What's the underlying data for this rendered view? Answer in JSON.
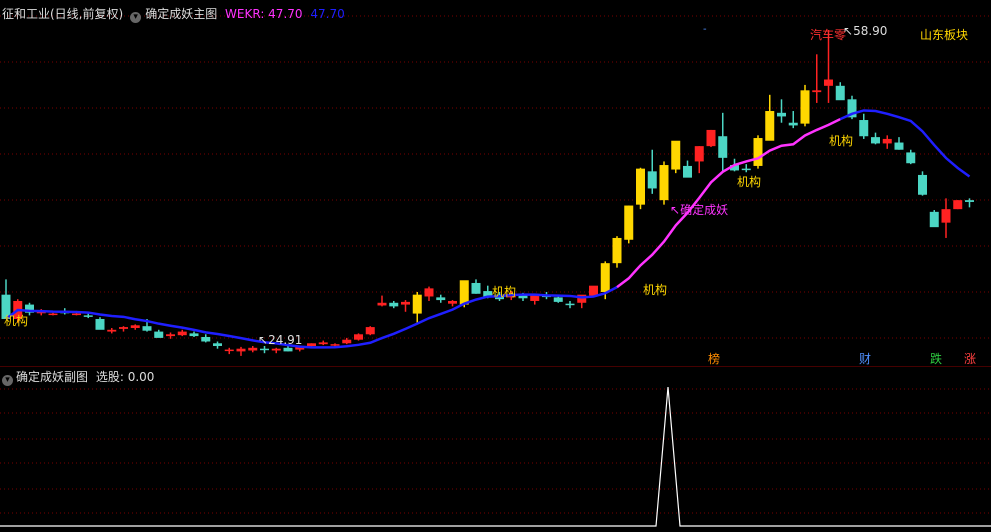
{
  "main": {
    "stock_title": "征和工业(日线,前复权)",
    "indicator_name": "确定成妖主图",
    "wekr_label": "WEKR: 47.70",
    "wekr_value2": "47.70",
    "high_label": "58.90",
    "low_label": "24.91",
    "signal_label": "确定成妖",
    "sector_label": "汽车零",
    "sector2_label": "山东板块",
    "inst_label": "机构",
    "dash_label": "-",
    "bottom_markers": [
      {
        "text": "榜",
        "color": "#ff8c00"
      },
      {
        "text": "财",
        "color": "#4f8fff"
      },
      {
        "text": "跌",
        "color": "#2ecc40"
      },
      {
        "text": "涨",
        "color": "#ff4040"
      }
    ]
  },
  "sub": {
    "title": "确定成妖副图",
    "value_label": "选股: 0.00"
  },
  "colors": {
    "up_red": "#ff2222",
    "down_cyan": "#4cd6c4",
    "yellow": "#ffd700",
    "ma_blue": "#1f1fff",
    "ma_magenta": "#ff33ff",
    "grid_red": "#8b0000"
  },
  "chart_data": {
    "type": "candlestick",
    "price_high": 58.9,
    "price_low": 24.91,
    "indicator": {
      "name": "WEKR",
      "value": 47.7
    },
    "candles_ohlc": [
      [
        29.5,
        31.2,
        26.8,
        26.8
      ],
      [
        26.8,
        29.0,
        26.4,
        28.8
      ],
      [
        28.4,
        28.6,
        27.2,
        27.5
      ],
      [
        27.6,
        27.9,
        27.2,
        27.6
      ],
      [
        27.3,
        27.5,
        27.2,
        27.4
      ],
      [
        27.6,
        28.0,
        27.3,
        27.5
      ],
      [
        27.4,
        27.7,
        27.2,
        27.4
      ],
      [
        27.2,
        27.5,
        26.9,
        27.1
      ],
      [
        26.8,
        27.0,
        25.8,
        25.6
      ],
      [
        25.4,
        25.8,
        25.2,
        25.6
      ],
      [
        25.7,
        26.0,
        25.4,
        25.9
      ],
      [
        25.8,
        26.2,
        25.6,
        26.1
      ],
      [
        26.0,
        26.8,
        25.4,
        25.5
      ],
      [
        25.4,
        25.6,
        24.8,
        24.7
      ],
      [
        24.9,
        25.3,
        24.6,
        25.1
      ],
      [
        25.0,
        25.6,
        24.9,
        25.4
      ],
      [
        25.2,
        25.4,
        24.8,
        24.9
      ],
      [
        24.8,
        25.1,
        24.2,
        24.3
      ],
      [
        24.1,
        24.3,
        23.5,
        23.8
      ],
      [
        23.4,
        23.6,
        22.9,
        23.4
      ],
      [
        23.2,
        23.7,
        22.7,
        23.5
      ],
      [
        23.3,
        23.8,
        23.1,
        23.6
      ],
      [
        23.5,
        23.8,
        23.0,
        23.4
      ],
      [
        23.3,
        23.6,
        23.0,
        23.5
      ],
      [
        23.6,
        23.9,
        23.2,
        23.2
      ],
      [
        23.4,
        23.8,
        23.2,
        23.7
      ],
      [
        23.8,
        24.1,
        23.6,
        24.1
      ],
      [
        24.0,
        24.4,
        23.9,
        24.2
      ],
      [
        24.0,
        24.1,
        23.7,
        24.0
      ],
      [
        24.1,
        24.7,
        24.0,
        24.5
      ],
      [
        24.5,
        25.2,
        24.4,
        25.1
      ],
      [
        25.1,
        26.0,
        25.0,
        25.9
      ],
      [
        28.3,
        29.4,
        28.2,
        28.6
      ],
      [
        28.6,
        28.8,
        28.0,
        28.2
      ],
      [
        28.4,
        28.9,
        27.6,
        28.7
      ],
      [
        27.4,
        29.8,
        26.4,
        29.5
      ],
      [
        29.3,
        30.4,
        28.8,
        30.2
      ],
      [
        29.2,
        29.5,
        28.6,
        28.9
      ],
      [
        28.5,
        28.9,
        28.2,
        28.8
      ],
      [
        28.4,
        30.8,
        28.1,
        31.1
      ],
      [
        30.8,
        31.2,
        29.6,
        29.6
      ],
      [
        29.9,
        30.5,
        29.1,
        29.3
      ],
      [
        29.5,
        29.8,
        28.8,
        29.0
      ],
      [
        29.2,
        29.9,
        28.9,
        29.6
      ],
      [
        29.5,
        29.7,
        28.8,
        29.1
      ],
      [
        28.8,
        29.6,
        28.4,
        29.5
      ],
      [
        29.4,
        29.8,
        29.0,
        29.3
      ],
      [
        29.2,
        29.4,
        28.6,
        28.7
      ],
      [
        28.5,
        28.8,
        28.0,
        28.4
      ],
      [
        28.6,
        29.3,
        28.0,
        29.5
      ],
      [
        29.4,
        30.3,
        29.3,
        30.5
      ],
      [
        29.8,
        33.2,
        29.0,
        33.0
      ],
      [
        33.0,
        36.0,
        32.5,
        35.8
      ],
      [
        35.6,
        39.4,
        35.2,
        39.4
      ],
      [
        39.5,
        43.6,
        39.0,
        43.5
      ],
      [
        43.2,
        45.6,
        40.7,
        41.3
      ],
      [
        40.0,
        44.3,
        39.5,
        43.9
      ],
      [
        43.4,
        46.5,
        43.0,
        46.6
      ],
      [
        43.8,
        44.4,
        42.8,
        42.5
      ],
      [
        44.3,
        46.0,
        43.0,
        46.0
      ],
      [
        46.0,
        47.8,
        45.9,
        47.8
      ],
      [
        47.1,
        49.7,
        43.1,
        44.7
      ],
      [
        43.9,
        44.6,
        43.2,
        43.3
      ],
      [
        43.5,
        44.0,
        43.1,
        43.4
      ],
      [
        43.8,
        47.2,
        43.5,
        46.9
      ],
      [
        46.6,
        51.7,
        48.1,
        49.9
      ],
      [
        49.7,
        51.2,
        48.6,
        49.3
      ],
      [
        48.6,
        49.9,
        48.0,
        48.3
      ],
      [
        48.5,
        52.8,
        48.2,
        52.2
      ],
      [
        52.0,
        56.2,
        50.8,
        52.2
      ],
      [
        52.7,
        58.9,
        50.8,
        53.4
      ],
      [
        52.7,
        53.1,
        51.2,
        51.1
      ],
      [
        51.2,
        51.6,
        49.0,
        49.2
      ],
      [
        48.9,
        49.6,
        46.8,
        47.1
      ],
      [
        47.0,
        47.5,
        46.2,
        46.3
      ],
      [
        46.3,
        47.2,
        45.7,
        46.8
      ],
      [
        46.4,
        47.0,
        45.6,
        45.6
      ],
      [
        45.3,
        45.6,
        44.0,
        44.1
      ],
      [
        42.8,
        43.2,
        40.5,
        40.6
      ],
      [
        38.7,
        38.9,
        37.5,
        37.0
      ],
      [
        37.5,
        40.2,
        35.8,
        39.0
      ],
      [
        39.0,
        40.0,
        39.0,
        40.0
      ],
      [
        40.0,
        40.2,
        39.2,
        39.8
      ]
    ]
  }
}
